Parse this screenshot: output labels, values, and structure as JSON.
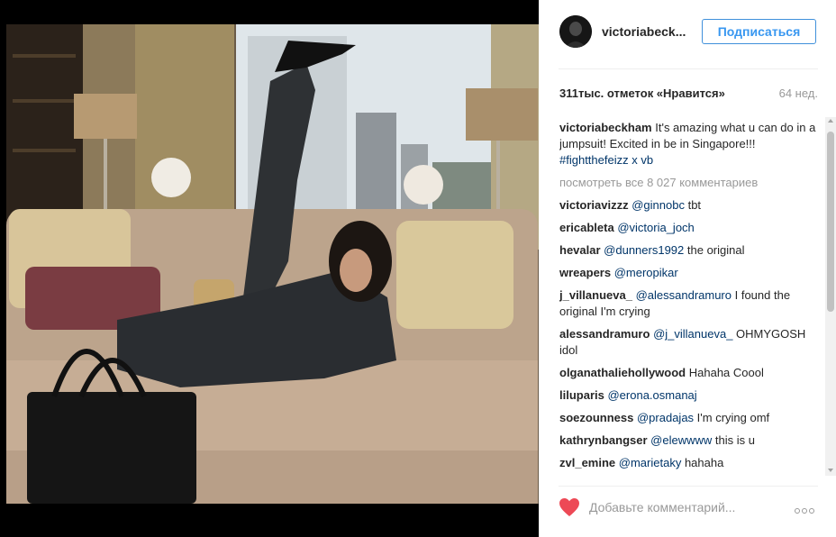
{
  "post": {
    "username": "victoriabeck...",
    "follow_label": "Подписаться",
    "likes": "311тыс. отметок «Нравится»",
    "age": "64 нед."
  },
  "comments": [
    {
      "user": "victoriabeckham",
      "text": "It's amazing what u can do in a jumpsuit! Excited in be in Singapore!!! ",
      "mention": "#fightthefeizz x vb",
      "after": ""
    },
    {
      "view_all": "посмотреть все 8 027 комментариев"
    },
    {
      "user": "victoriavizzz",
      "text": "",
      "mention": "@ginnobc",
      "after": " tbt"
    },
    {
      "user": "ericableta",
      "text": "",
      "mention": "@victoria_joch",
      "after": ""
    },
    {
      "user": "hevalar",
      "text": "",
      "mention": "@dunners1992",
      "after": " the original"
    },
    {
      "user": "wreapers",
      "text": "",
      "mention": "@meropikar",
      "after": ""
    },
    {
      "user": "j_villanueva_",
      "text": "",
      "mention": "@alessandramuro",
      "after": " I found the original I'm crying"
    },
    {
      "user": "alessandramuro",
      "text": "",
      "mention": "@j_villanueva_",
      "after": " OHMYGOSH idol"
    },
    {
      "user": "olganathaliehollywood",
      "text": "Hahaha Coool",
      "mention": "",
      "after": ""
    },
    {
      "user": "liluparis",
      "text": "",
      "mention": "@erona.osmanaj",
      "after": ""
    },
    {
      "user": "soezounness",
      "text": "",
      "mention": "@pradajas",
      "after": " I'm crying omf"
    },
    {
      "user": "kathrynbangser",
      "text": "",
      "mention": "@elewwww",
      "after": " this is u"
    },
    {
      "user": "zvl_emine",
      "text": "",
      "mention": "@marietaky",
      "after": " hahaha"
    }
  ],
  "add_comment": {
    "placeholder": "Добавьте комментарий..."
  },
  "icons": {
    "like": "heart-icon",
    "more": "more-options-icon"
  },
  "colors": {
    "accent": "#3897f0",
    "heart": "#ed4956",
    "mention": "#003569"
  }
}
